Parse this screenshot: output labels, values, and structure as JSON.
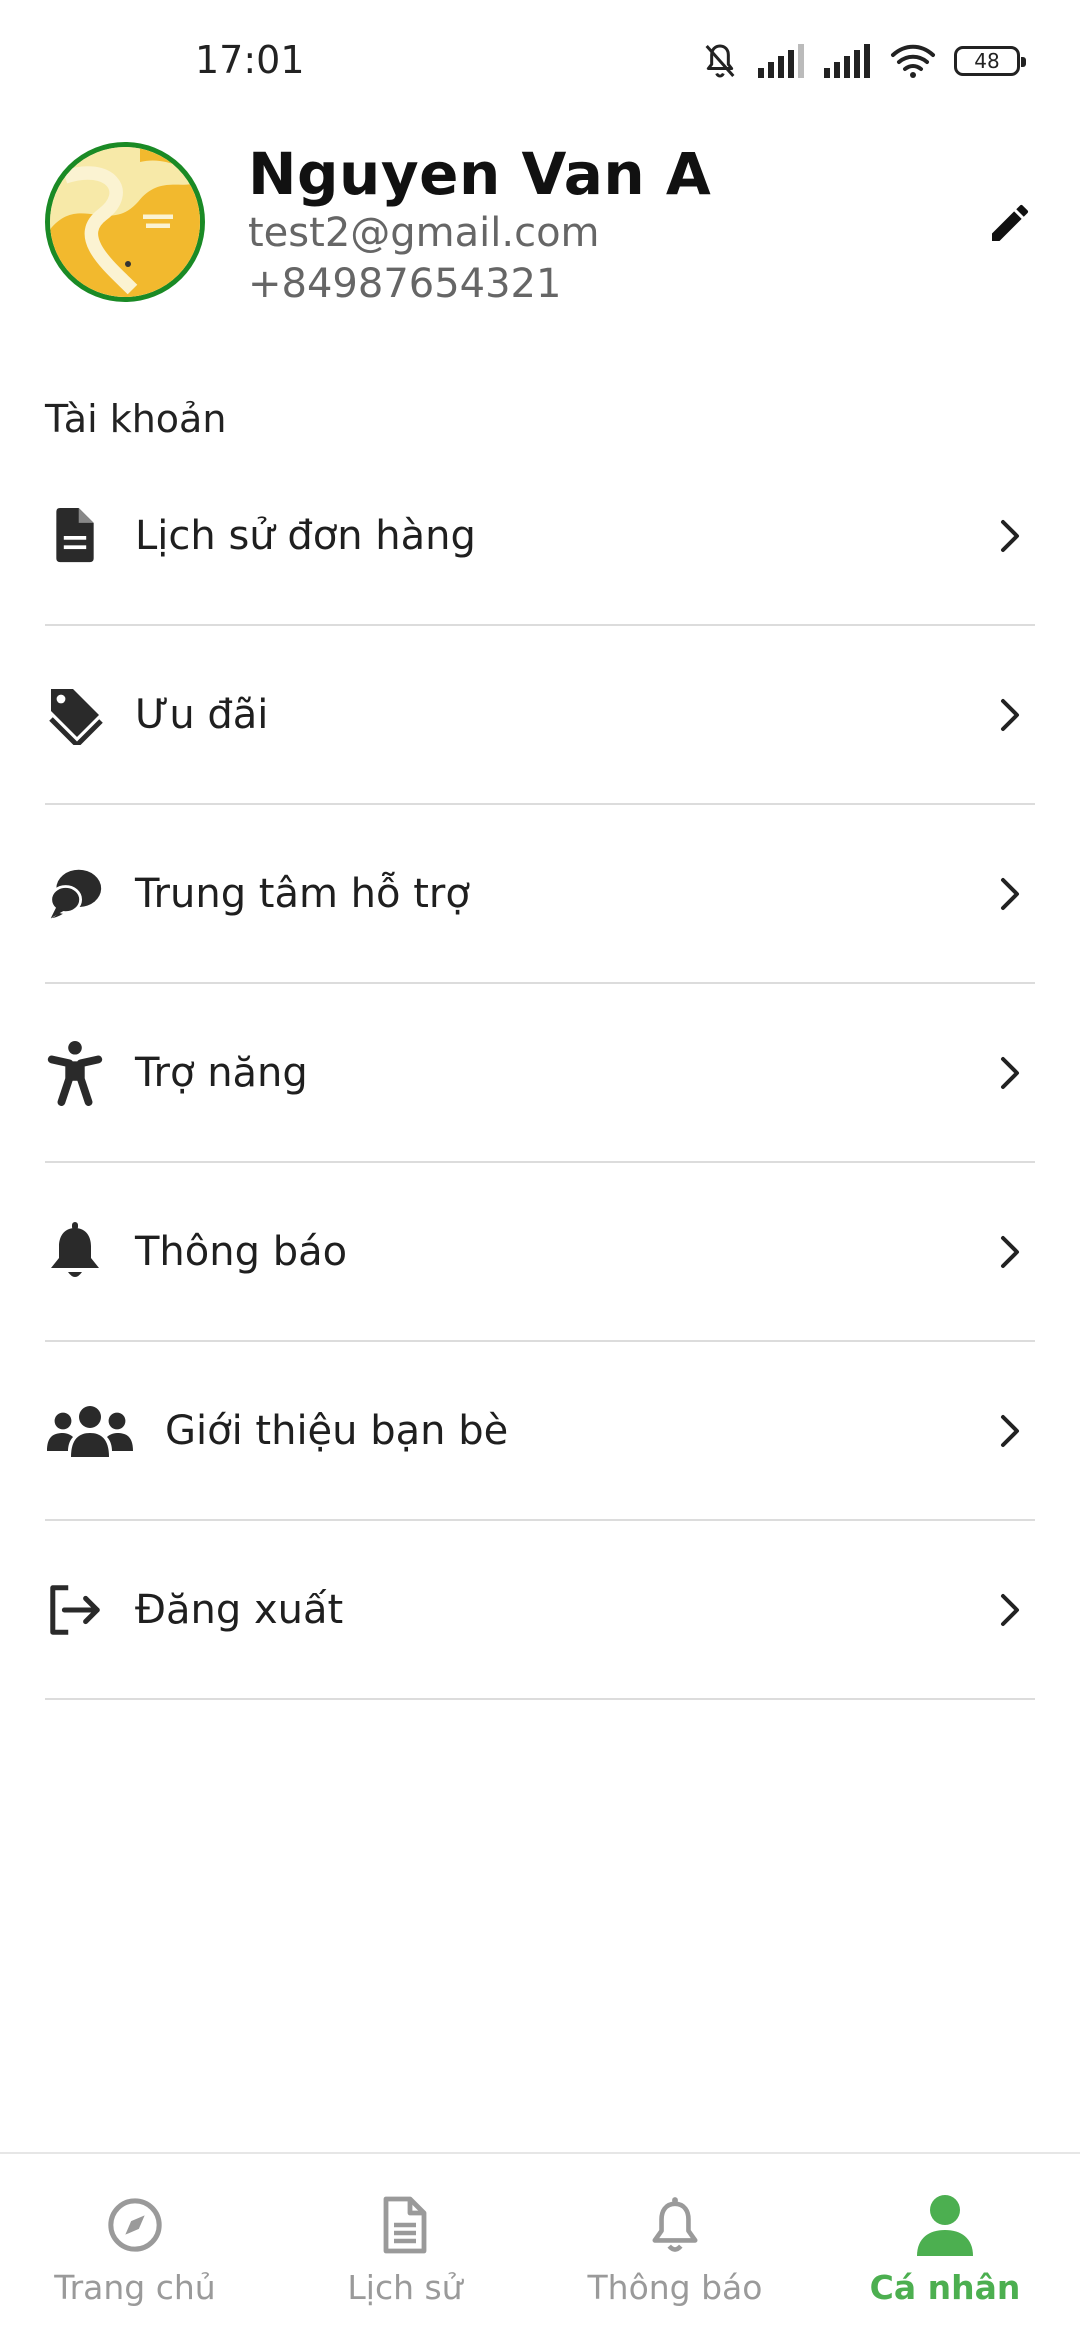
{
  "status_bar": {
    "time": "17:01",
    "battery": "48",
    "icons": [
      "bell-off-icon",
      "signal-icon",
      "signal-icon",
      "wifi-icon",
      "battery-icon"
    ]
  },
  "profile": {
    "name": "Nguyen Van A",
    "email": "test2@gmail.com",
    "phone": "+84987654321",
    "ring_color": "#1a8a25"
  },
  "section": {
    "title": "Tài khoản"
  },
  "menu": [
    {
      "label": "Lịch sử đơn hàng",
      "icon": "document-icon"
    },
    {
      "label": "Ưu đãi",
      "icon": "tag-icon"
    },
    {
      "label": "Trung tâm hỗ trợ",
      "icon": "chat-bubbles-icon"
    },
    {
      "label": "Trợ năng",
      "icon": "accessibility-icon"
    },
    {
      "label": "Thông báo",
      "icon": "bell-icon"
    },
    {
      "label": "Giới thiệu bạn bè",
      "icon": "users-icon"
    },
    {
      "label": "Đăng xuất",
      "icon": "logout-icon"
    }
  ],
  "bottom_nav": {
    "items": [
      {
        "label": "Trang chủ",
        "icon": "compass-icon",
        "active": false
      },
      {
        "label": "Lịch sử",
        "icon": "document-icon",
        "active": false
      },
      {
        "label": "Thông báo",
        "icon": "bell-icon",
        "active": false
      },
      {
        "label": "Cá nhân",
        "icon": "person-icon",
        "active": true
      }
    ],
    "active_color": "#4caf50",
    "inactive_color": "#9a9a9a"
  }
}
